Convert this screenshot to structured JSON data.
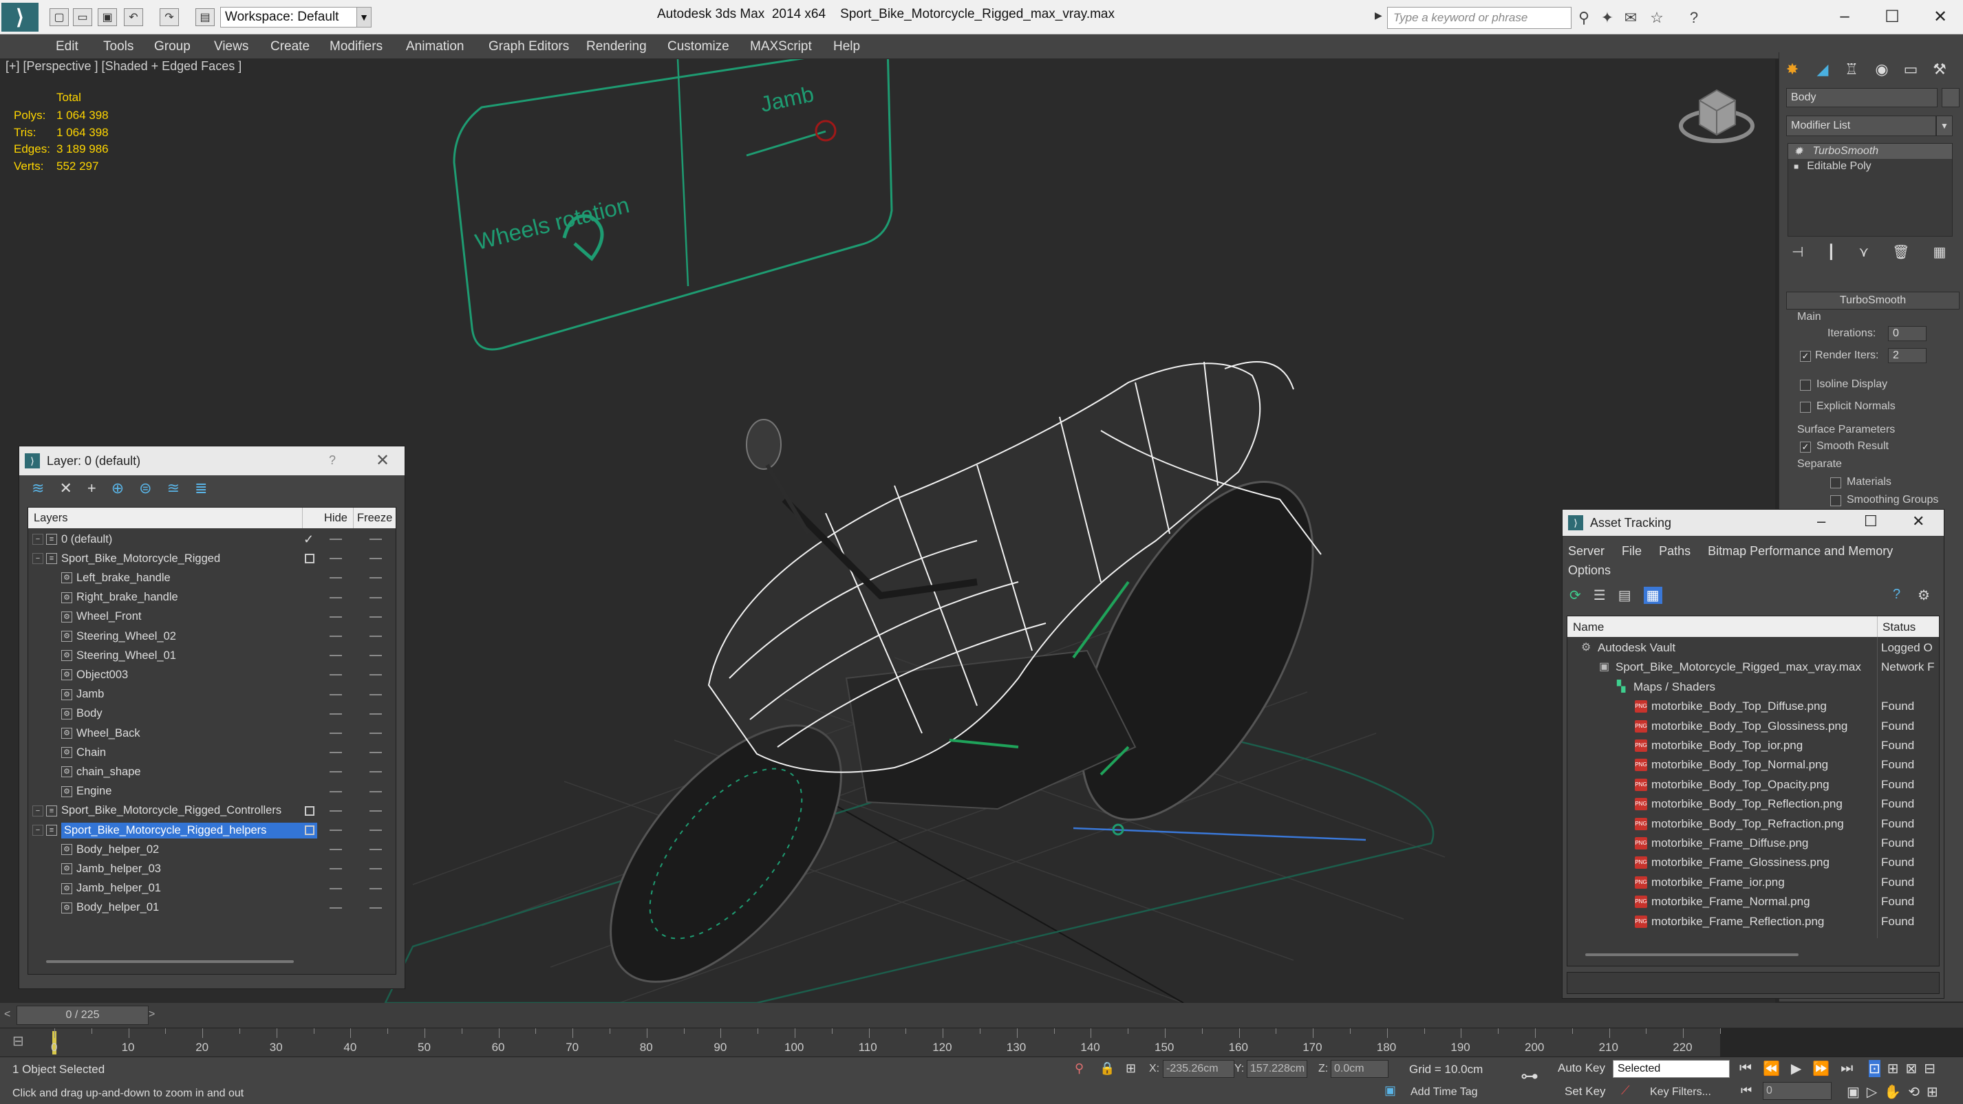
{
  "titlebar": {
    "workspace_label": "Workspace: Default",
    "app_title": "Autodesk 3ds Max  2014 x64",
    "file_name": "Sport_Bike_Motorcycle_Rigged_max_vray.max",
    "search_placeholder": "Type a keyword or phrase"
  },
  "menubar": [
    "Edit",
    "Tools",
    "Group",
    "Views",
    "Create",
    "Modifiers",
    "Animation",
    "Graph Editors",
    "Rendering",
    "Customize",
    "MAXScript",
    "Help"
  ],
  "viewport": {
    "label": "[+] [Perspective ] [Shaded + Edged Faces ]",
    "stats_header": "Total",
    "stats": [
      {
        "label": "Polys:",
        "value": "1 064 398"
      },
      {
        "label": "Tris:",
        "value": "1 064 398"
      },
      {
        "label": "Edges:",
        "value": "3 189 986"
      },
      {
        "label": "Verts:",
        "value": "552 297"
      }
    ],
    "rig_labels": {
      "wheels": "Wheels rotation",
      "jamb": "Jamb"
    }
  },
  "command_panel": {
    "object_name": "Body",
    "modifier_list_label": "Modifier List",
    "stack": [
      "TurboSmooth",
      "Editable Poly"
    ],
    "rollout_title": "TurboSmooth",
    "main_label": "Main",
    "iterations_label": "Iterations:",
    "iterations_value": "0",
    "render_iters_label": "Render Iters:",
    "render_iters_value": "2",
    "isoline_label": "Isoline Display",
    "explicit_normals_label": "Explicit Normals",
    "surface_params_label": "Surface Parameters",
    "smooth_result_label": "Smooth Result",
    "separate_label": "Separate",
    "materials_label": "Materials",
    "smoothing_groups_label": "Smoothing Groups"
  },
  "layer_window": {
    "title": "Layer: 0 (default)",
    "help": "?",
    "col_layers": "Layers",
    "col_hide": "Hide",
    "col_freeze": "Freeze",
    "rows": [
      {
        "name": "0 (default)",
        "level": 0,
        "type": "layer",
        "current": true
      },
      {
        "name": "Sport_Bike_Motorcycle_Rigged",
        "level": 0,
        "type": "layer",
        "box": true
      },
      {
        "name": "Left_brake_handle",
        "level": 1,
        "type": "obj"
      },
      {
        "name": "Right_brake_handle",
        "level": 1,
        "type": "obj"
      },
      {
        "name": "Wheel_Front",
        "level": 1,
        "type": "obj"
      },
      {
        "name": "Steering_Wheel_02",
        "level": 1,
        "type": "obj"
      },
      {
        "name": "Steering_Wheel_01",
        "level": 1,
        "type": "obj"
      },
      {
        "name": "Object003",
        "level": 1,
        "type": "obj"
      },
      {
        "name": "Jamb",
        "level": 1,
        "type": "obj"
      },
      {
        "name": "Body",
        "level": 1,
        "type": "obj"
      },
      {
        "name": "Wheel_Back",
        "level": 1,
        "type": "obj"
      },
      {
        "name": "Chain",
        "level": 1,
        "type": "obj"
      },
      {
        "name": "chain_shape",
        "level": 1,
        "type": "obj"
      },
      {
        "name": "Engine",
        "level": 1,
        "type": "obj"
      },
      {
        "name": "Sport_Bike_Motorcycle_Rigged_Controllers",
        "level": 0,
        "type": "layer",
        "box": true
      },
      {
        "name": "Sport_Bike_Motorcycle_Rigged_helpers",
        "level": 0,
        "type": "layer",
        "box": true,
        "selected": true
      },
      {
        "name": "Body_helper_02",
        "level": 1,
        "type": "obj"
      },
      {
        "name": "Jamb_helper_03",
        "level": 1,
        "type": "obj"
      },
      {
        "name": "Jamb_helper_01",
        "level": 1,
        "type": "obj"
      },
      {
        "name": "Body_helper_01",
        "level": 1,
        "type": "obj"
      }
    ]
  },
  "asset_window": {
    "title": "Asset Tracking",
    "menu": [
      "Server",
      "File",
      "Paths",
      "Bitmap Performance and Memory",
      "Options"
    ],
    "col_name": "Name",
    "col_status": "Status",
    "rows": [
      {
        "name": "Autodesk Vault",
        "status": "Logged O",
        "level": 0,
        "icon": "vault"
      },
      {
        "name": "Sport_Bike_Motorcycle_Rigged_max_vray.max",
        "status": "Network F",
        "level": 1,
        "icon": "max"
      },
      {
        "name": "Maps / Shaders",
        "status": "",
        "level": 2,
        "icon": "folder"
      },
      {
        "name": "motorbike_Body_Top_Diffuse.png",
        "status": "Found",
        "level": 3,
        "icon": "png"
      },
      {
        "name": "motorbike_Body_Top_Glossiness.png",
        "status": "Found",
        "level": 3,
        "icon": "png"
      },
      {
        "name": "motorbike_Body_Top_ior.png",
        "status": "Found",
        "level": 3,
        "icon": "png"
      },
      {
        "name": "motorbike_Body_Top_Normal.png",
        "status": "Found",
        "level": 3,
        "icon": "png"
      },
      {
        "name": "motorbike_Body_Top_Opacity.png",
        "status": "Found",
        "level": 3,
        "icon": "png"
      },
      {
        "name": "motorbike_Body_Top_Reflection.png",
        "status": "Found",
        "level": 3,
        "icon": "png"
      },
      {
        "name": "motorbike_Body_Top_Refraction.png",
        "status": "Found",
        "level": 3,
        "icon": "png"
      },
      {
        "name": "motorbike_Frame_Diffuse.png",
        "status": "Found",
        "level": 3,
        "icon": "png"
      },
      {
        "name": "motorbike_Frame_Glossiness.png",
        "status": "Found",
        "level": 3,
        "icon": "png"
      },
      {
        "name": "motorbike_Frame_ior.png",
        "status": "Found",
        "level": 3,
        "icon": "png"
      },
      {
        "name": "motorbike_Frame_Normal.png",
        "status": "Found",
        "level": 3,
        "icon": "png"
      },
      {
        "name": "motorbike_Frame_Reflection.png",
        "status": "Found",
        "level": 3,
        "icon": "png"
      }
    ]
  },
  "timeline": {
    "frame_label": "0 / 225",
    "ticks": [
      "0",
      "10",
      "20",
      "30",
      "40",
      "50",
      "60",
      "70",
      "80",
      "90",
      "100",
      "110",
      "120",
      "130",
      "140",
      "150",
      "160",
      "170",
      "180",
      "190",
      "200",
      "210",
      "220"
    ]
  },
  "status": {
    "selection": "1 Object Selected",
    "hint": "Click and drag up-and-down to zoom in and out",
    "x_label": "X:",
    "x_value": "-235.26cm",
    "y_label": "Y:",
    "y_value": "157.228cm",
    "z_label": "Z:",
    "z_value": "0.0cm",
    "grid": "Grid = 10.0cm",
    "add_time_tag": "Add Time Tag",
    "auto_key": "Auto Key",
    "set_key": "Set Key",
    "selected_value": "Selected",
    "key_filters": "Key Filters...",
    "frame_value": "0"
  },
  "colors": {
    "accent": "#2e6b74",
    "selection": "#3375d6",
    "stats": "#ffd600",
    "rig_green": "#1e9c72"
  }
}
